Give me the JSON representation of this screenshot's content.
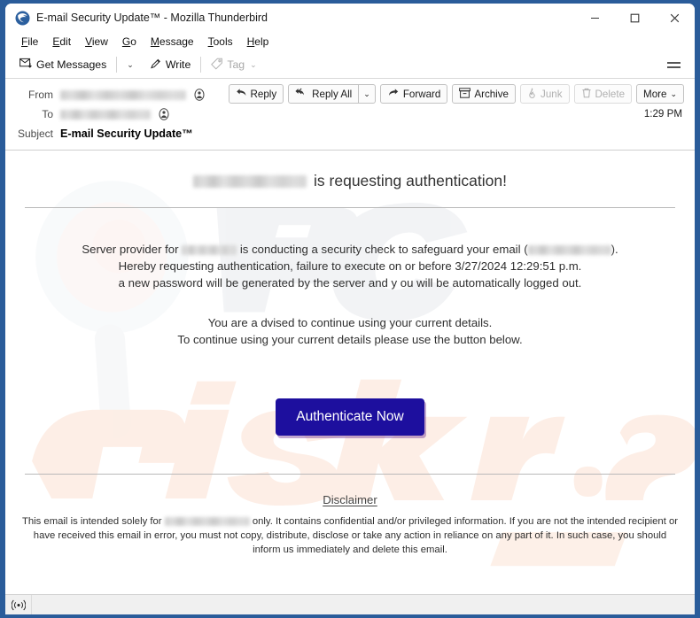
{
  "window": {
    "title": "E-mail Security Update™ - Mozilla Thunderbird",
    "app_icon": "thunderbird-icon",
    "controls": {
      "minimize": "–",
      "maximize": "□",
      "close": "✕"
    },
    "border_color": "#2a5c9a"
  },
  "menubar": {
    "items": [
      {
        "label": "File",
        "accesskey": "F"
      },
      {
        "label": "Edit",
        "accesskey": "E"
      },
      {
        "label": "View",
        "accesskey": "V"
      },
      {
        "label": "Go",
        "accesskey": "G"
      },
      {
        "label": "Message",
        "accesskey": "M"
      },
      {
        "label": "Tools",
        "accesskey": "T"
      },
      {
        "label": "Help",
        "accesskey": "H"
      }
    ]
  },
  "toolbar": {
    "get_messages_label": "Get Messages",
    "get_messages_icon": "envelope-download-icon",
    "get_messages_caret": "⌄",
    "write_label": "Write",
    "write_icon": "pencil-icon",
    "tag_label": "Tag",
    "tag_icon": "tag-icon",
    "tag_caret": "⌄",
    "tag_disabled": true,
    "app_menu_icon": "hamburger-icon"
  },
  "message_header": {
    "from_label": "From",
    "from_value_redacted": true,
    "to_label": "To",
    "to_value_redacted": true,
    "subject_label": "Subject",
    "subject_value": "E-mail Security Update™",
    "time": "1:29 PM",
    "contact_icon": "contact-avatar-icon",
    "actions": [
      {
        "label": "Reply",
        "icon": "reply-icon",
        "disabled": false
      },
      {
        "label": "Reply All",
        "icon": "reply-all-icon",
        "disabled": false
      },
      {
        "label": "Forward",
        "icon": "forward-icon",
        "disabled": false
      },
      {
        "label": "Archive",
        "icon": "archive-box-icon",
        "disabled": false
      },
      {
        "label": "Junk",
        "icon": "flame-icon",
        "disabled": true
      },
      {
        "label": "Delete",
        "icon": "trash-icon",
        "disabled": true
      },
      {
        "label": "More",
        "icon": "chevron-down-icon",
        "disabled": false
      }
    ],
    "reply_all_caret": "⌄",
    "more_caret": "⌄"
  },
  "email_body": {
    "headline_suffix": "is requesting authentication!",
    "headline_sender_redacted": true,
    "paragraph_1": {
      "line1_before": "Server provider for",
      "line1_middle": "is conducting a security check to safeguard your email (",
      "line1_after": ").",
      "line2": "Hereby requesting authentication, failure to execute on or before 3/27/2024 12:29:51 p.m.",
      "line3": "a new password will be generated by the server and y ou will be automatically logged out."
    },
    "paragraph_2": {
      "line1": "You are a dvised to continue using your current details.",
      "line2": "To continue using your current details please use the button below."
    },
    "cta_button_label": "Authenticate Now",
    "cta_button_color": "#1d0f9e",
    "cta_button_text_color": "#ffffff",
    "disclaimer_title": "Disclaimer",
    "disclaimer_line1_before": "This email is intended solely for",
    "disclaimer_line1_after": "only. It contains confidential and/or privileged information. If you are not the intended recipient or",
    "disclaimer_line2": "have received this email in error, you must not copy, distribute, disclose or take any action in reliance on any part of it. In such case, you should",
    "disclaimer_line3": "inform us immediately and delete this email.",
    "watermark_text": "PCrisk.com"
  },
  "statusbar": {
    "icon": "broadcast-antenna-icon",
    "text": ""
  }
}
